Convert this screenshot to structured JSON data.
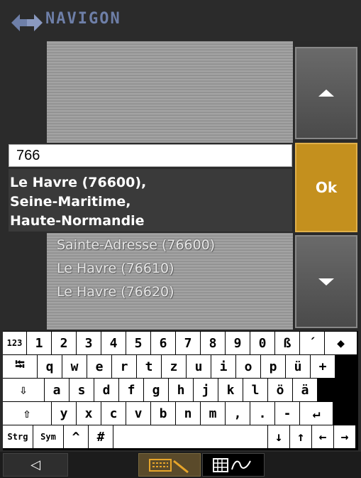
{
  "header": {
    "brand": "NAVIGON"
  },
  "search": {
    "value": "766"
  },
  "results": {
    "selected": [
      "Le Havre (76600),",
      "Seine-Maritime,",
      "Haute-Normandie"
    ],
    "items": [
      "Sainte-Adresse (76600)",
      "Le Havre (76610)",
      "Le Havre (76620)"
    ]
  },
  "buttons": {
    "ok": "Ok",
    "scroll_up": "scroll-up-icon",
    "scroll_down": "scroll-down-icon"
  },
  "keyboard": {
    "row1": [
      "123",
      "1",
      "2",
      "3",
      "4",
      "5",
      "6",
      "7",
      "8",
      "9",
      "0",
      "ß",
      "´",
      "◆"
    ],
    "row2": [
      "⭾",
      "q",
      "w",
      "e",
      "r",
      "t",
      "z",
      "u",
      "i",
      "o",
      "p",
      "ü",
      "+"
    ],
    "row3": [
      "⇩",
      "a",
      "s",
      "d",
      "f",
      "g",
      "h",
      "j",
      "k",
      "l",
      "ö",
      "ä"
    ],
    "row4": [
      "⇧",
      "y",
      "x",
      "c",
      "v",
      "b",
      "n",
      "m",
      ",",
      ".",
      "-",
      "↵"
    ],
    "row5": [
      "Strg",
      "Sym",
      "^",
      "#",
      " ",
      "↓",
      "↑",
      "←",
      "→"
    ]
  },
  "bottombar": {
    "back": "◁",
    "keyboard_mode": "keyboard-icon",
    "handwriting_mode": "handwriting-icon"
  },
  "colors": {
    "accent": "#c4901e",
    "brand": "#6e7fa8"
  }
}
